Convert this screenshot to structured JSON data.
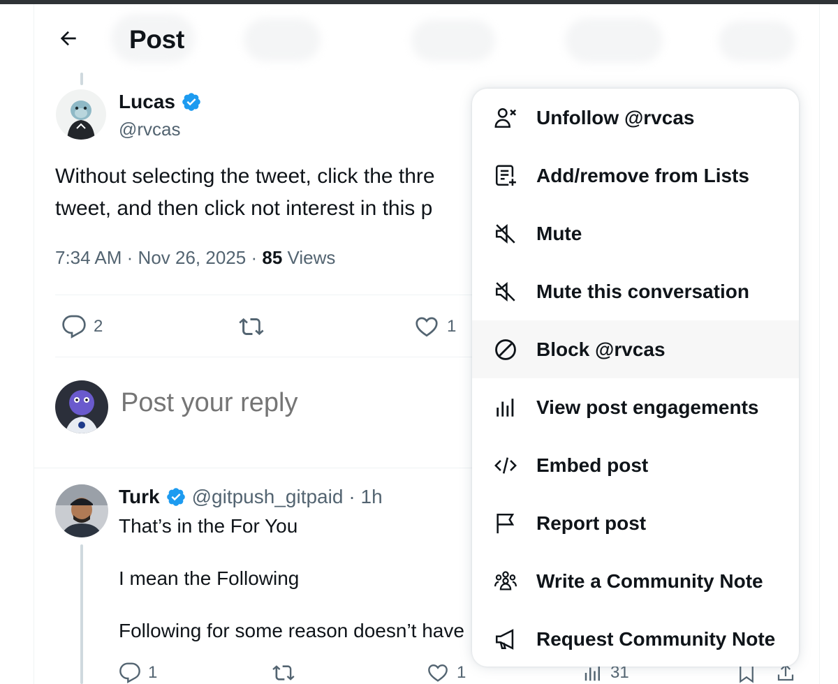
{
  "header": {
    "title": "Post"
  },
  "post": {
    "author_name": "Lucas",
    "author_handle": "@rvcas",
    "text_line_1": "Without selecting the tweet, click the thre",
    "text_line_2": "tweet, and then click not interest in this p",
    "time": "7:34 AM",
    "date": "Nov 26, 2025",
    "views_count": "85",
    "views_label": "Views",
    "sep": "·",
    "reply_count": "2",
    "like_count": "1"
  },
  "compose": {
    "placeholder": "Post your reply"
  },
  "reply": {
    "author_name": "Turk",
    "author_handle": "@gitpush_gitpaid",
    "time": "· 1h",
    "line_1": "That’s in the For You",
    "line_2": "I mean the Following",
    "line_3": "Following for some reason doesn’t have",
    "reply_count": "1",
    "like_count": "1",
    "views_count": "31"
  },
  "menu": {
    "items": [
      {
        "label": "Unfollow @rvcas",
        "icon": "unfollow-icon"
      },
      {
        "label": "Add/remove from Lists",
        "icon": "list-add-icon"
      },
      {
        "label": "Mute",
        "icon": "mute-icon"
      },
      {
        "label": "Mute this conversation",
        "icon": "mute-icon"
      },
      {
        "label": "Block @rvcas",
        "icon": "block-icon"
      },
      {
        "label": "View post engagements",
        "icon": "engagements-icon"
      },
      {
        "label": "Embed post",
        "icon": "code-icon"
      },
      {
        "label": "Report post",
        "icon": "flag-icon"
      },
      {
        "label": "Write a Community Note",
        "icon": "community-icon"
      },
      {
        "label": "Request Community Note",
        "icon": "megaphone-icon"
      }
    ]
  },
  "colors": {
    "verified": "#1d9bf0",
    "text_primary": "#0f1419",
    "text_secondary": "#536471",
    "menu_hover": "#f7f7f7"
  }
}
